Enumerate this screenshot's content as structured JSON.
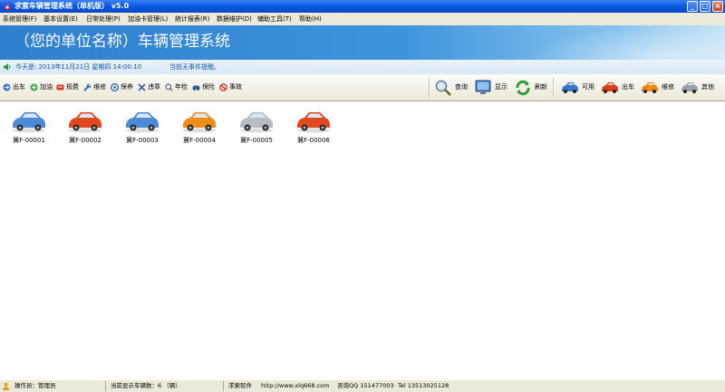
{
  "window": {
    "title": "求索车辆管理系统（单机版） v5.0",
    "controls": [
      "minimize",
      "maximize",
      "close"
    ]
  },
  "menu": [
    "系统管理(F)",
    "基本设置(E)",
    "日常处理(P)",
    "加油卡管理(L)",
    "统计报表(R)",
    "数据维护(D)",
    "辅助工具(T)",
    "帮助(H)"
  ],
  "banner": {
    "title": "（您的单位名称）车辆管理系统"
  },
  "info": {
    "date_text": "今天是: 2013年11月21日 星期四 14:00:10",
    "notice_text": "当前无事件提醒。"
  },
  "toolbar": {
    "left": [
      {
        "label": "出车",
        "icon": "car-out-icon"
      },
      {
        "label": "加油",
        "icon": "fuel-icon"
      },
      {
        "label": "规费",
        "icon": "fee-icon"
      },
      {
        "label": "维修",
        "icon": "wrench-icon"
      },
      {
        "label": "保养",
        "icon": "maintenance-icon"
      },
      {
        "label": "违章",
        "icon": "violation-icon"
      },
      {
        "label": "年检",
        "icon": "inspection-icon"
      },
      {
        "label": "保险",
        "icon": "insurance-icon"
      },
      {
        "label": "事故",
        "icon": "accident-icon"
      }
    ],
    "right_actions": [
      {
        "label": "查询",
        "icon": "magnifier-icon"
      },
      {
        "label": "显示",
        "icon": "monitor-icon"
      },
      {
        "label": "刷新",
        "icon": "refresh-icon"
      }
    ],
    "filters": [
      {
        "label": "可用",
        "icon": "car-blue-icon",
        "color": "#3a78c9"
      },
      {
        "label": "出车",
        "icon": "car-red-icon",
        "color": "#d8401c"
      },
      {
        "label": "维修",
        "icon": "car-orange-icon",
        "color": "#e88a1a"
      },
      {
        "label": "其他",
        "icon": "car-gray-icon",
        "color": "#9aa0a8"
      }
    ]
  },
  "vehicles": [
    {
      "plate": "冀F-00001",
      "status_color": "#4a8ad6"
    },
    {
      "plate": "冀F-00002",
      "status_color": "#e0481e"
    },
    {
      "plate": "冀F-00003",
      "status_color": "#4a8ad6"
    },
    {
      "plate": "冀F-00004",
      "status_color": "#ee8c1c"
    },
    {
      "plate": "冀F-00005",
      "status_color": "#b6bcc4"
    },
    {
      "plate": "冀F-00006",
      "status_color": "#e0481e"
    }
  ],
  "status": {
    "operator": "操作员：管理员",
    "vehicle_count": "当前显示车辆数：6 （辆）",
    "company": "求索软件",
    "website": "http://www.xlq668.com",
    "qq": "咨询QQ 1514770039",
    "tel": "Tel 13513025128"
  }
}
